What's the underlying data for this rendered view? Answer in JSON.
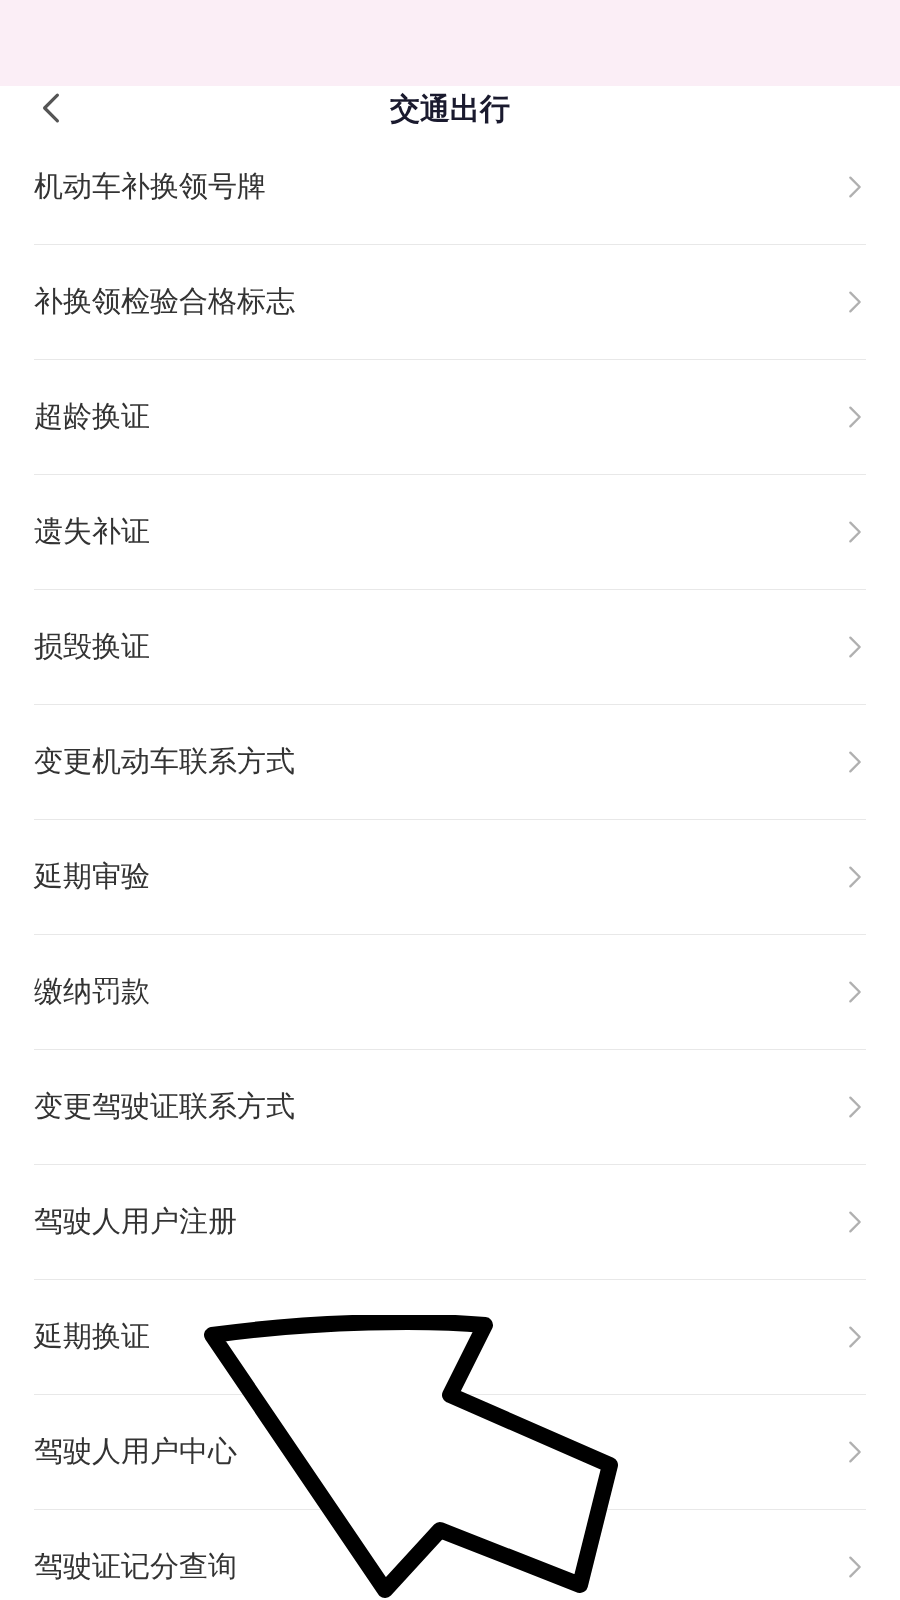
{
  "header": {
    "title": "交通出行"
  },
  "items": [
    {
      "label": "机动车补换领号牌"
    },
    {
      "label": "补换领检验合格标志"
    },
    {
      "label": "超龄换证"
    },
    {
      "label": "遗失补证"
    },
    {
      "label": "损毁换证"
    },
    {
      "label": "变更机动车联系方式"
    },
    {
      "label": "延期审验"
    },
    {
      "label": "缴纳罚款"
    },
    {
      "label": "变更驾驶证联系方式"
    },
    {
      "label": "驾驶人用户注册"
    },
    {
      "label": "延期换证"
    },
    {
      "label": "驾驶人用户中心"
    },
    {
      "label": "驾驶证记分查询"
    }
  ]
}
